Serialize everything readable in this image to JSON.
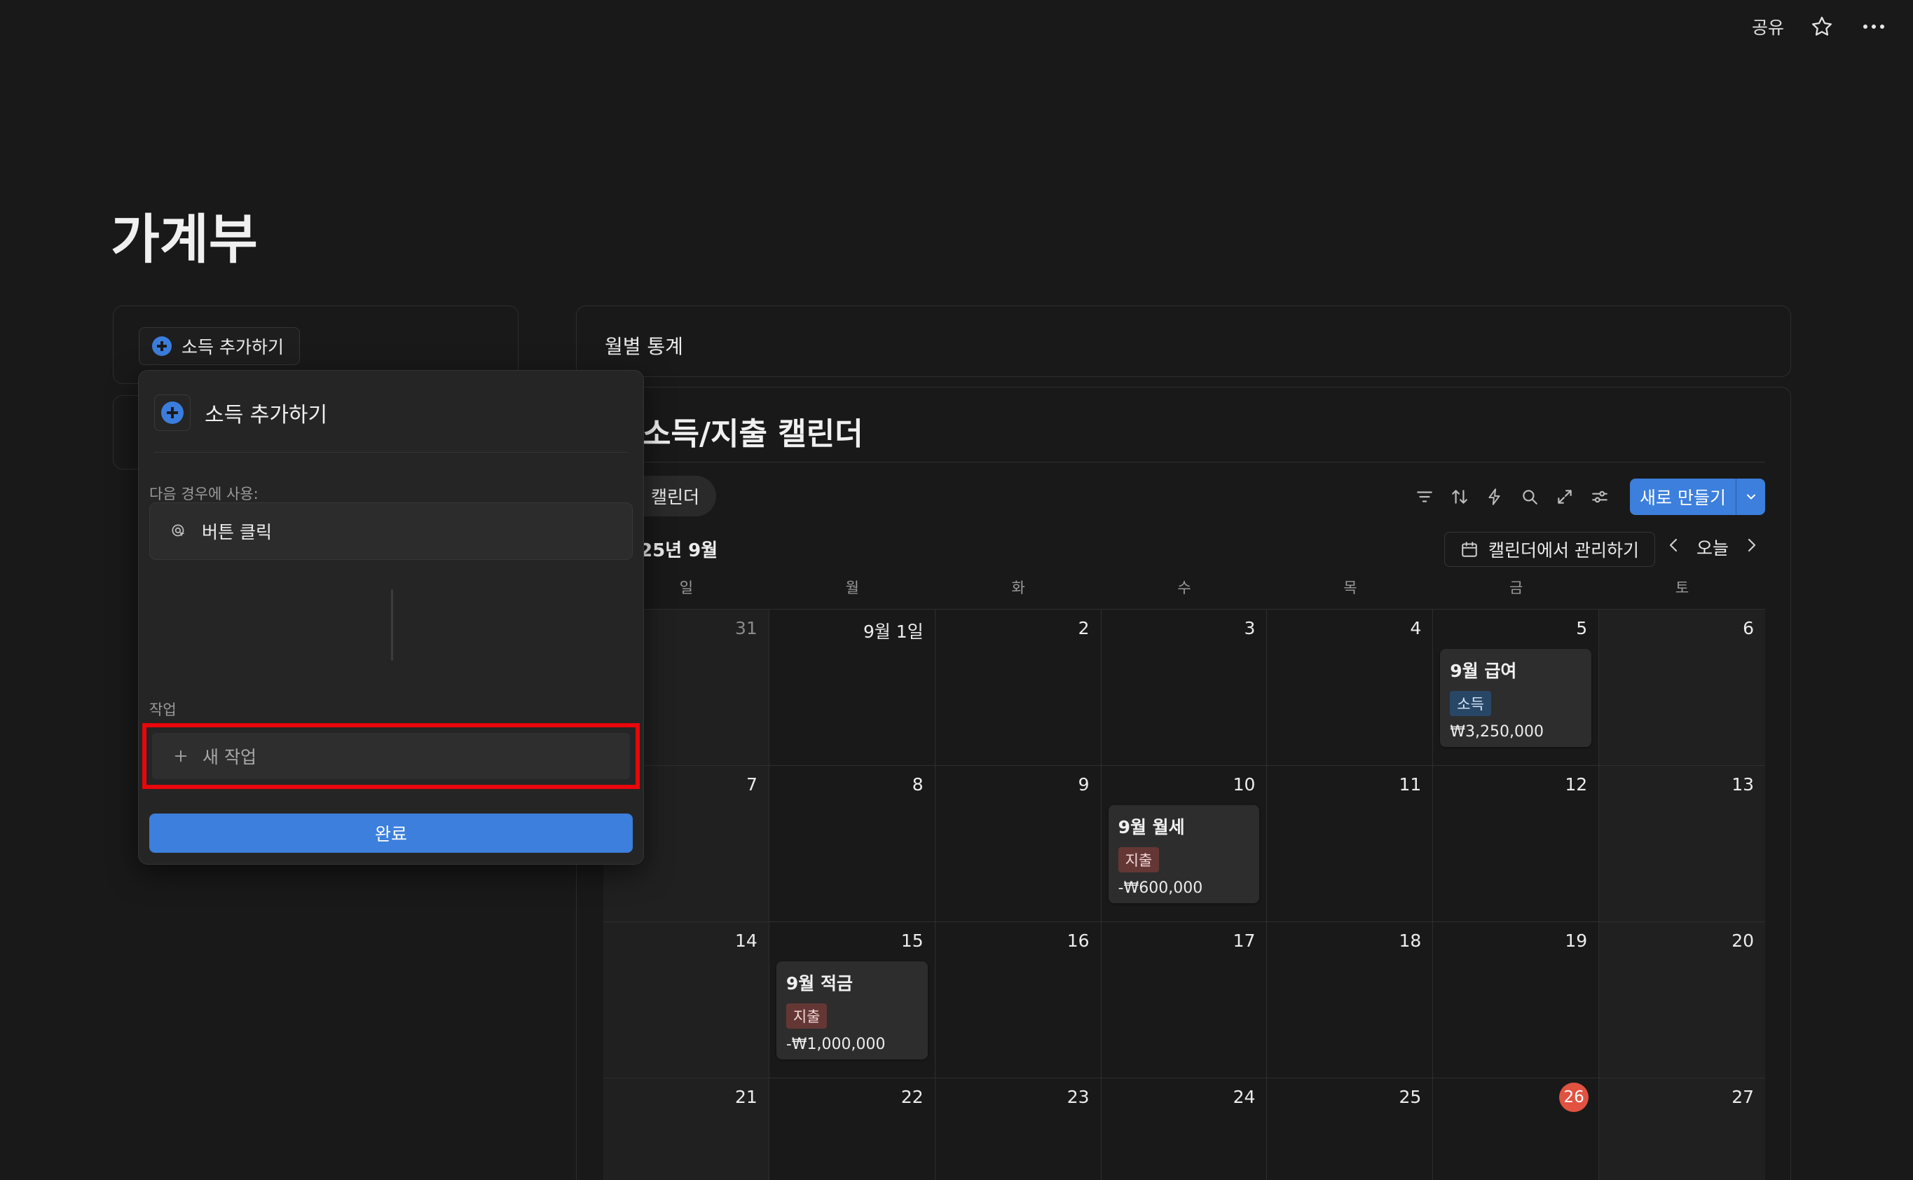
{
  "topbar": {
    "share": "공유"
  },
  "page": {
    "title": "가계부"
  },
  "left": {
    "income_button": "소득 추가하기"
  },
  "popup": {
    "title": "소득 추가하기",
    "trigger_label": "다음 경우에 사용:",
    "trigger_value": "버튼 클릭",
    "actions_label": "작업",
    "new_action": "새 작업",
    "done": "완료"
  },
  "stats": {
    "title": "월별 통계"
  },
  "calendar": {
    "title": "소득/지출 캘린더",
    "view_tab": "캘린더",
    "new_button": "새로 만들기",
    "month": "25년 9월",
    "manage": "캘린더에서 관리하기",
    "today": "오늘",
    "weekdays": [
      "일",
      "월",
      "화",
      "수",
      "목",
      "금",
      "토"
    ],
    "days": [
      {
        "label": "31",
        "muted": true
      },
      {
        "label": "9월 1일"
      },
      {
        "label": "2"
      },
      {
        "label": "3"
      },
      {
        "label": "4"
      },
      {
        "label": "5"
      },
      {
        "label": "6"
      },
      {
        "label": "7"
      },
      {
        "label": "8"
      },
      {
        "label": "9"
      },
      {
        "label": "10"
      },
      {
        "label": "11"
      },
      {
        "label": "12"
      },
      {
        "label": "13"
      },
      {
        "label": "14"
      },
      {
        "label": "15"
      },
      {
        "label": "16"
      },
      {
        "label": "17"
      },
      {
        "label": "18"
      },
      {
        "label": "19"
      },
      {
        "label": "20"
      },
      {
        "label": "21"
      },
      {
        "label": "22"
      },
      {
        "label": "23"
      },
      {
        "label": "24"
      },
      {
        "label": "25"
      },
      {
        "label": "26",
        "today": true
      },
      {
        "label": "27"
      }
    ],
    "events": [
      {
        "day_index": 5,
        "title": "9월 급여",
        "tag": "소득",
        "tag_type": "income",
        "amount": "₩3,250,000"
      },
      {
        "day_index": 10,
        "title": "9월 월세",
        "tag": "지출",
        "tag_type": "expense",
        "amount": "-₩600,000"
      },
      {
        "day_index": 15,
        "title": "9월 적금",
        "tag": "지출",
        "tag_type": "expense",
        "amount": "-₩1,000,000"
      }
    ]
  },
  "colors": {
    "accent": "#3c7fdc",
    "highlight": "#e8070b",
    "today": "#e15241"
  }
}
